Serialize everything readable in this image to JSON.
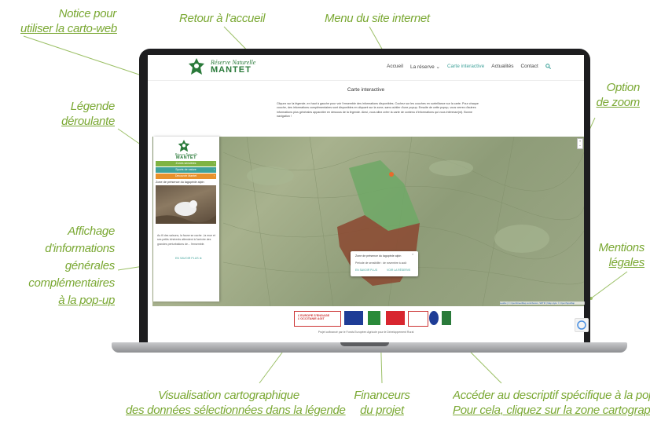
{
  "annotations": {
    "notice": {
      "line1": "Notice pour",
      "line2": "utiliser la carto-web"
    },
    "home": "Retour à l'accueil",
    "menu": "Menu du site internet",
    "zoom": {
      "line1": "Option",
      "line2": "de zoom"
    },
    "legend": {
      "line1": "Légende",
      "line2": "déroulante"
    },
    "mentions": {
      "line1": "Mentions",
      "line2": "légales"
    },
    "info": {
      "line1": "Affichage",
      "line2": "d'informations",
      "line3": "générales",
      "line4": "complémentaires",
      "line5": "à la pop-up"
    },
    "visu": {
      "line1": "Visualisation cartographique",
      "line2": "des données sélectionnées dans la légende"
    },
    "funders": {
      "line1": "Financeurs",
      "line2": "du projet"
    },
    "descr": {
      "line1": "Accéder au descriptif spécifique à la pop-up",
      "line2": "Pour cela, cliquez sur la zone cartographique"
    }
  },
  "site": {
    "logo_line1": "Réserve Naturelle",
    "logo_line2": "MANTET",
    "nav": [
      "Accueil",
      "La réserve ⌄",
      "Carte interactive",
      "Actualités",
      "Contact"
    ],
    "search_icon": "🔍",
    "page_title": "Carte interactive",
    "intro": "Cliquez sur la légende, en haut à gauche pour voir l'ensemble des informations disponibles. Cochez sur les couches en surbrillance sur la carte. Pour chaque couche, des informations complémentaires sont disponibles en cliquant sur la zone, sans oublier d'une popup. Ensuite de cette popup, vous verrez d'autres informations plus générales apparaître en dessous de la légende. Ainsi, vous allez créer la carte de contenu d'informations qui vous intéresse(nt). Bonne navigation !"
  },
  "legend_panel": {
    "logo_line1": "Réserve Naturelle",
    "logo_line2": "MANTET",
    "buttons": [
      "Zones sensibles",
      "Sports de nature",
      "Découvrir Mantet"
    ],
    "zone_title": "Zone de présence du lagopède alpin",
    "text": "Au fil des saisons, la faune se cache ; la mue et ses petits inhérents attendent à l'arrivée des grandes perturbations de... l'ensemble.",
    "more": "EN SAVOIR PLUS"
  },
  "popup": {
    "title": "Zone de présence du lagopède alpin",
    "period": "Période de sensibilité : de novembre à août",
    "link1": "EN SAVOIR PLUS",
    "link2": "VOIR LA RÉSERVE",
    "close": "×"
  },
  "zoom_controls": {
    "plus": "+",
    "minus": "−"
  },
  "attribution": "Leaflet | © OpenStreetMap contributors, SRTM | Map style: © OpenTopoMap",
  "funders": {
    "europe_line1": "L'EUROPE S'ENGAGE",
    "europe_line2": "L'OCCITANIE AGIT",
    "credit": "Projet cofinancé par le Fonds Européen Agricole pour le Développement Rural"
  },
  "colors": {
    "accent": "#7aa833",
    "teal": "#3fa29a",
    "zone_brown": "#8b4a32",
    "zone_green": "#6fa866"
  }
}
